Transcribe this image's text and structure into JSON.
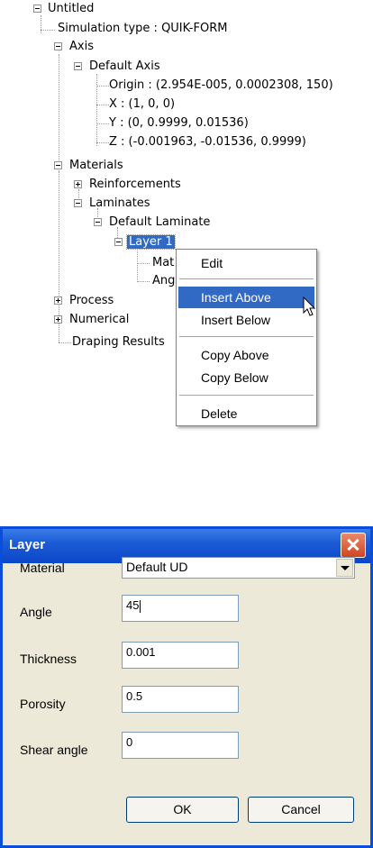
{
  "tree": {
    "root": "Untitled",
    "simulation_type": "Simulation type : QUIK-FORM",
    "axis": "Axis",
    "default_axis": "Default Axis",
    "origin": "Origin : (2.954E-005, 0.0002308, 150)",
    "x": "X : (1, 0, 0)",
    "y": "Y : (0, 0.9999, 0.01536)",
    "z": "Z : (-0.001963, -0.01536, 0.9999)",
    "materials": "Materials",
    "reinforcements": "Reinforcements",
    "laminates": "Laminates",
    "default_laminate": "Default Laminate",
    "layer1": "Layer 1",
    "material_partial": "Mat",
    "angle_partial": "Ang",
    "process": "Process",
    "numerical": "Numerical",
    "draping_results": "Draping Results"
  },
  "context_menu": {
    "items": [
      "Edit",
      "Insert Above",
      "Insert Below",
      "Copy Above",
      "Copy Below",
      "Delete"
    ],
    "highlighted": "Insert Above"
  },
  "dialog": {
    "title": "Layer",
    "fields": {
      "material": {
        "label": "Material",
        "value": "Default UD"
      },
      "angle": {
        "label": "Angle",
        "value": "45"
      },
      "thickness": {
        "label": "Thickness",
        "value": "0.001"
      },
      "porosity": {
        "label": "Porosity",
        "value": "0.5"
      },
      "shear_angle": {
        "label": "Shear angle",
        "value": "0"
      }
    },
    "ok_label": "OK",
    "cancel_label": "Cancel"
  }
}
